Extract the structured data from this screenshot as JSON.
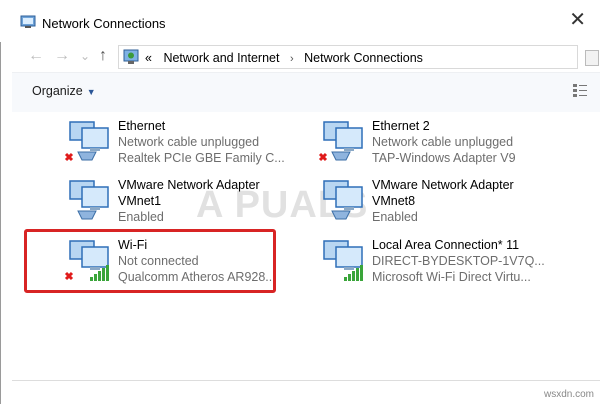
{
  "window": {
    "title": "Network Connections",
    "close_glyph": "✕"
  },
  "nav": {
    "back_glyph": "←",
    "forward_glyph": "→",
    "dropdown_glyph": "⌄",
    "up_glyph": "↑"
  },
  "address": {
    "prefix": "«",
    "crumbs": [
      "Network and Internet",
      "Network Connections"
    ],
    "separator": "›"
  },
  "toolbar": {
    "organize_label": "Organize",
    "organize_caret": "▼"
  },
  "connections": [
    {
      "name": "Ethernet",
      "line2": "Network cable unplugged",
      "line3": "Realtek PCIe GBE Family C...",
      "status": "disconnected",
      "type": "wired"
    },
    {
      "name": "Ethernet 2",
      "line2": "Network cable unplugged",
      "line3": "TAP-Windows Adapter V9",
      "status": "disconnected",
      "type": "wired"
    },
    {
      "name": "VMware Network Adapter",
      "line2": "VMnet1",
      "line3": "Enabled",
      "status": "enabled",
      "type": "wired"
    },
    {
      "name": "VMware Network Adapter",
      "line2": "VMnet8",
      "line3": "Enabled",
      "status": "enabled",
      "type": "wired"
    },
    {
      "name": "Wi-Fi",
      "line2": "Not connected",
      "line3": "Qualcomm Atheros AR928...",
      "status": "disconnected",
      "type": "wireless"
    },
    {
      "name": "Local Area Connection* 11",
      "line2": "DIRECT-BYDESKTOP-1V7Q...",
      "line3": "Microsoft Wi-Fi Direct Virtu...",
      "status": "enabled",
      "type": "wireless"
    }
  ],
  "watermark": "A PUALS",
  "site_mark": "wsxdn.com",
  "colors": {
    "highlight": "#d82424",
    "disconnect_x": "#e01b1b",
    "signal_bars": "#3aa53a",
    "monitor": "#2f6fb8"
  }
}
